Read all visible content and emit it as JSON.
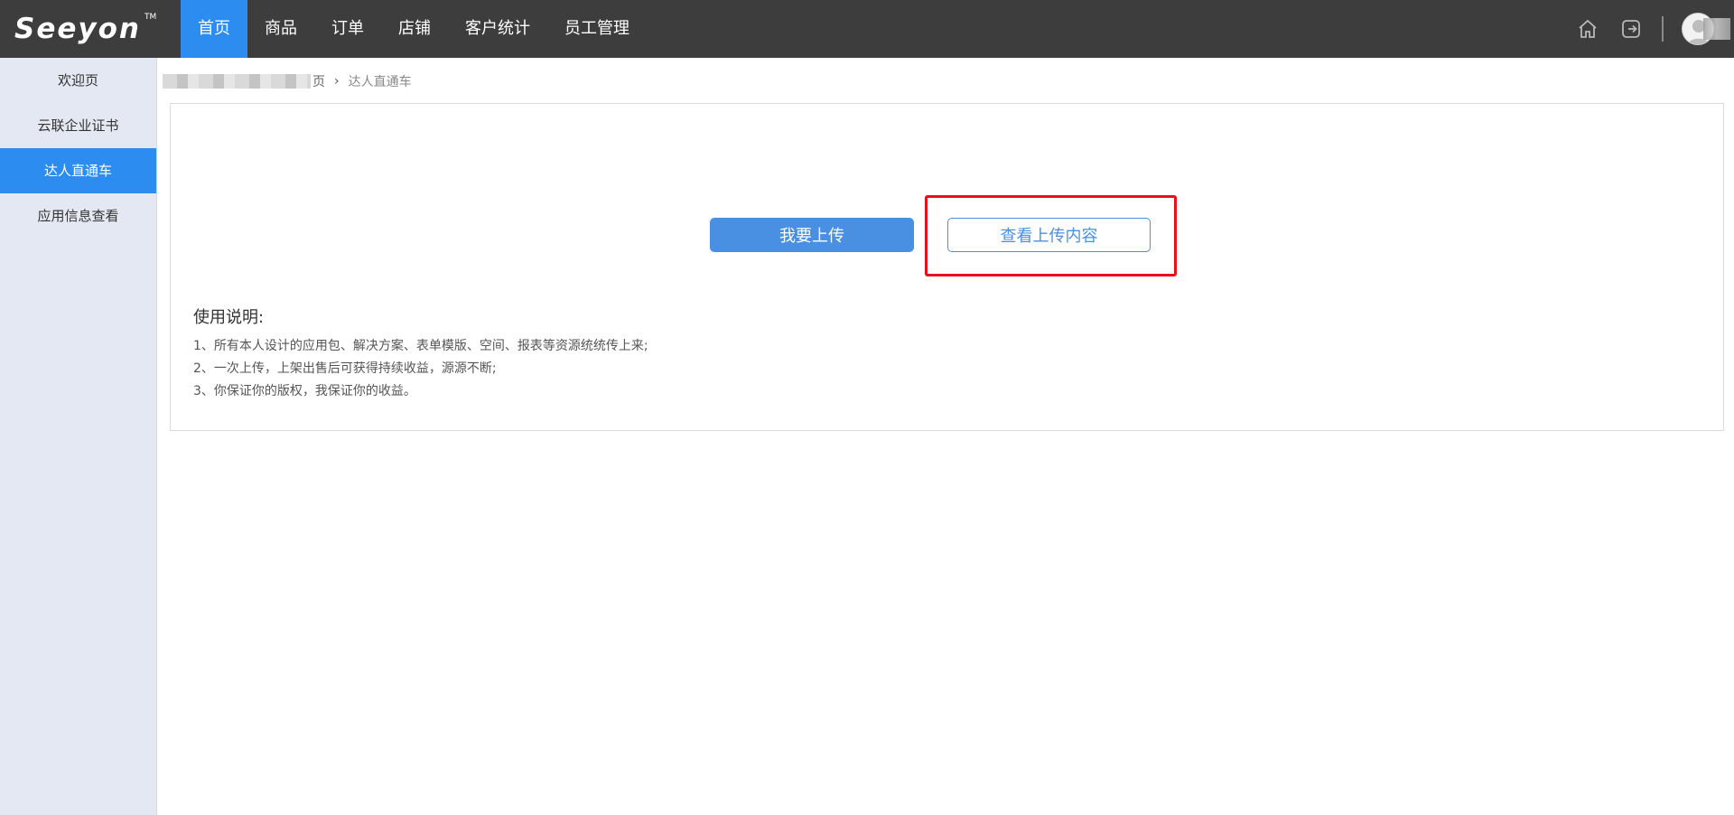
{
  "logo": {
    "text": "Seeyon",
    "tm": "TM"
  },
  "nav": {
    "items": [
      {
        "label": "首页",
        "active": true
      },
      {
        "label": "商品",
        "active": false
      },
      {
        "label": "订单",
        "active": false
      },
      {
        "label": "店铺",
        "active": false
      },
      {
        "label": "客户统计",
        "active": false
      },
      {
        "label": "员工管理",
        "active": false
      }
    ]
  },
  "top_icons": {
    "home": "home-icon",
    "logout": "logout-icon"
  },
  "sidebar": {
    "items": [
      {
        "label": "欢迎页",
        "active": false
      },
      {
        "label": "云联企业证书",
        "active": false
      },
      {
        "label": "达人直通车",
        "active": true
      },
      {
        "label": "应用信息查看",
        "active": false
      }
    ]
  },
  "breadcrumb": {
    "home_tail": "页",
    "separator": "›",
    "current": "达人直通车"
  },
  "main": {
    "upload_button": "我要上传",
    "view_button": "查看上传内容",
    "usage_title": "使用说明:",
    "usage_lines": [
      "1、所有本人设计的应用包、解决方案、表单模版、空间、报表等资源统统传上来;",
      "2、一次上传，上架出售后可获得持续收益，源源不断;",
      "3、你保证你的版权，我保证你的收益。"
    ]
  },
  "colors": {
    "topbar": "#3d3d3d",
    "accent": "#2d8cf0",
    "button": "#4a90e2",
    "sidebar": "#e4e8f2",
    "highlight": "#e8101a"
  }
}
